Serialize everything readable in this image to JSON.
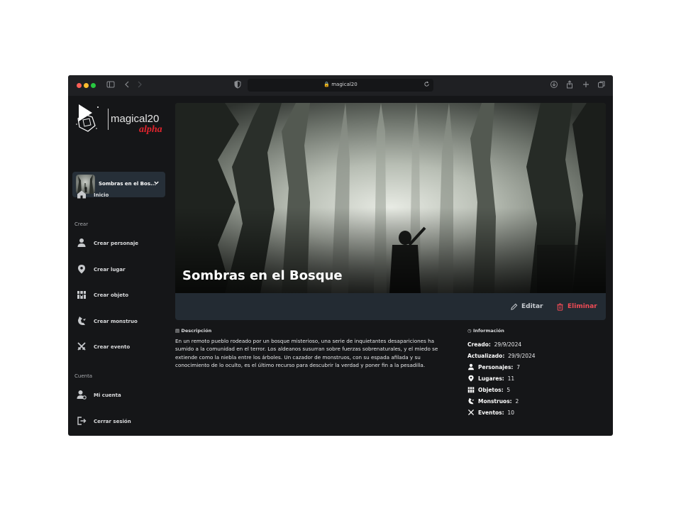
{
  "browser": {
    "url": "magical20"
  },
  "logo": {
    "name": "magical20",
    "tagline": "alpha"
  },
  "adventure": {
    "title": "Sombras en el Bos..."
  },
  "nav": {
    "home": "Inicio",
    "create_section": "Crear",
    "create_character": "Crear personaje",
    "create_place": "Crear lugar",
    "create_object": "Crear objeto",
    "create_monster": "Crear monstruo",
    "create_event": "Crear evento",
    "account_section": "Cuenta",
    "my_account": "Mi cuenta",
    "logout": "Cerrar sesión"
  },
  "hero": {
    "title": "Sombras en el Bosque"
  },
  "actions": {
    "edit": "Editar",
    "delete": "Eliminar"
  },
  "description": {
    "heading": "Descripción",
    "text": "En un remoto pueblo rodeado por un bosque misterioso, una serie de inquietantes desapariciones ha sumido a la comunidad en el terror. Los aldeanos susurran sobre fuerzas sobrenaturales, y el miedo se extiende como la niebla entre los árboles. Un cazador de monstruos, con su espada afilada y su conocimiento de lo oculto, es el último recurso para descubrir la verdad y poner fin a la pesadilla."
  },
  "info": {
    "heading": "Información",
    "created_label": "Creado:",
    "created": "29/9/2024",
    "updated_label": "Actualizado:",
    "updated": "29/9/2024",
    "characters_label": "Personajes:",
    "characters": "7",
    "places_label": "Lugares:",
    "places": "11",
    "objects_label": "Objetos:",
    "objects": "5",
    "monsters_label": "Monstruos:",
    "monsters": "2",
    "events_label": "Eventos:",
    "events": "10"
  },
  "colors": {
    "accent": "#e0242d",
    "danger": "#ef4b55",
    "panel": "#232b33",
    "background": "#151618"
  }
}
